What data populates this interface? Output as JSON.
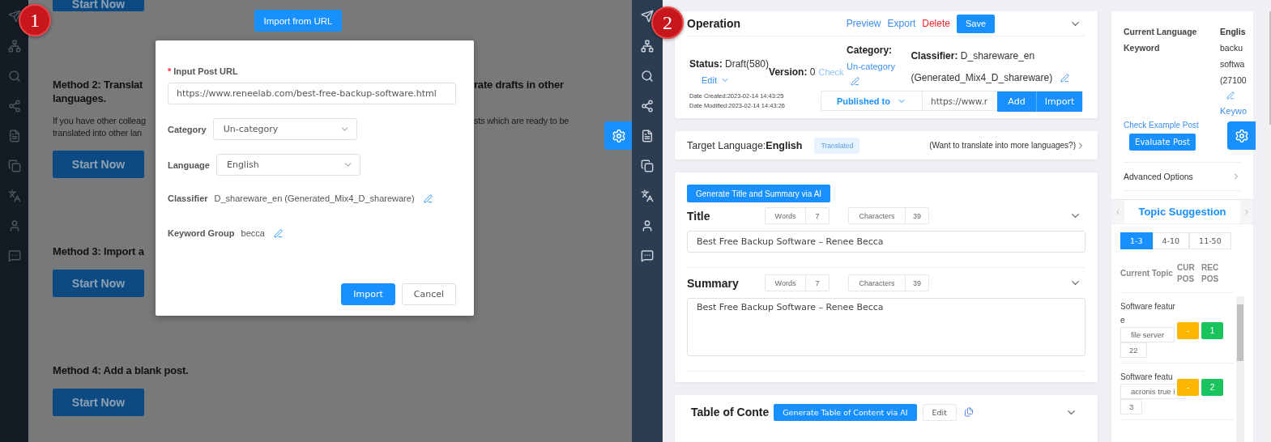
{
  "left_screen": {
    "badge": "1",
    "top_button": "Start Now",
    "import_button": "Import from URL",
    "methods": [
      {
        "heading": [
          "Method 2:  Translat",
          "rate drafts in other"
        ],
        "heading_2": "languages.",
        "body": [
          [
            "If you have other colleag",
            "sts which are ready to be"
          ],
          [
            "translated into other lan"
          ]
        ],
        "button": "Start Now"
      },
      {
        "heading": [
          "Method 3: Import a"
        ],
        "button": "Start Now"
      },
      {
        "heading": [
          "Method 4: Add a blank post."
        ],
        "button": "Start Now"
      }
    ],
    "dialog": {
      "fields": [
        {
          "kind": "input",
          "required_mark": "*",
          "label": "Input Post URL",
          "value": "https://www.reneelab.com/best-free-backup-software.html"
        },
        {
          "kind": "select",
          "label": "Category",
          "value": "Un-category"
        },
        {
          "kind": "select",
          "label": "Language",
          "value": "English"
        },
        {
          "kind": "text",
          "label": "Classifier",
          "value": "D_shareware_en (Generated_Mix4_D_shareware)"
        },
        {
          "kind": "text",
          "label": "Keyword Group",
          "value": "becca"
        }
      ],
      "buttons": [
        {
          "label": "Import",
          "primary": true
        },
        {
          "label": "Cancel",
          "primary": false
        }
      ]
    }
  },
  "right_screen": {
    "badge": "2",
    "operation": {
      "title": "Operation",
      "actions": [
        {
          "label": "Preview",
          "kind": "link"
        },
        {
          "label": "Export",
          "kind": "link"
        },
        {
          "label": "Delete",
          "kind": "danger"
        },
        {
          "label": "Save",
          "kind": "primary"
        }
      ],
      "status_label": "Status:",
      "status_value": "Draft(580)",
      "edit_link": "Edit",
      "version_label": "Version:",
      "version_value": "0",
      "check_link": "Check",
      "category_label": "Category:",
      "category_value": "Un-category",
      "classifier_label": "Classifier:",
      "classifier_value": [
        "D_shareware_en",
        "(Generated_Mix4_D_shareware)"
      ],
      "date_created": "Date Created:2023-02-14 14:43:25",
      "date_modified": "Date Modified:2023-02-14 14:43:26",
      "publish_dropdown": "Published to",
      "url_value": "https://www.r",
      "buttons": [
        "Add",
        "Import"
      ]
    },
    "target": {
      "label": "Target Language:",
      "value": "English",
      "tag": "Translated",
      "more": "(Want to translate into more languages?)"
    },
    "editor": {
      "ai_button": "Generate Title and Summary via AI",
      "fields": [
        {
          "kind": "input",
          "label": "Title",
          "words_label": "Words",
          "words": "7",
          "chars_label": "Characters",
          "chars": "39",
          "value": "Best Free Backup Software – Renee Becca"
        },
        {
          "kind": "textarea",
          "label": "Summary",
          "words_label": "Words",
          "words": "7",
          "chars_label": "Characters",
          "chars": "39",
          "value": "Best Free Backup Software – Renee Becca"
        }
      ]
    },
    "toc": {
      "title": "Table of Conte",
      "ai_button": "Generate Table of Content via AI",
      "edit_button": "Edit"
    },
    "side": {
      "rows": [
        {
          "label": "Current Language",
          "value": [
            "Englis"
          ]
        },
        {
          "label": "Keyword",
          "value": [
            "backu",
            "softwa",
            "(27100"
          ]
        }
      ],
      "keyword_link": "Keywo",
      "example_link": "Check Example Post",
      "evaluate_button": "Evaluate Post",
      "advanced": "Advanced Options"
    },
    "topics": {
      "title": "Topic Suggestion",
      "ranges": [
        {
          "label": "1-3",
          "selected": true
        },
        {
          "label": "4-10",
          "selected": false
        },
        {
          "label": "11-50",
          "selected": false
        }
      ],
      "columns": [
        "Current Topic",
        "CUR POS",
        "REC POS"
      ],
      "rows": [
        {
          "topic": "Software feature",
          "keyword": "file server",
          "count": "22",
          "cur": "-",
          "rec": "1"
        },
        {
          "topic": "Software featu",
          "keyword": "acronis true i",
          "count": "3",
          "cur": "-",
          "rec": "2"
        }
      ]
    }
  }
}
